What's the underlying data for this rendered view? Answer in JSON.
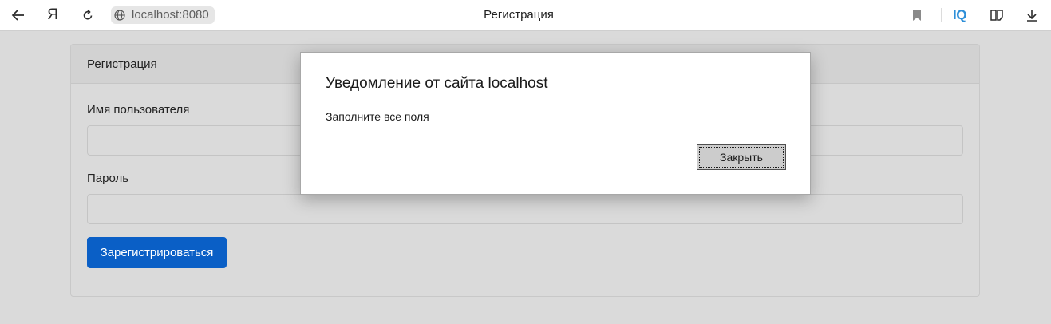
{
  "browser": {
    "address": "localhost:8080",
    "tab_title": "Регистрация",
    "yandex_label": "Я",
    "iq_label": "IQ",
    "icons": [
      "back-arrow-icon",
      "yandex-logo-icon",
      "reload-icon",
      "globe-icon",
      "bookmark-icon",
      "iq-icon",
      "book-icon",
      "download-icon"
    ]
  },
  "page": {
    "card_title": "Регистрация",
    "username_label": "Имя пользователя",
    "username_value": "",
    "password_label": "Пароль",
    "password_value": "",
    "submit_label": "Зарегистрироваться",
    "accent_color": "#0a5fc6"
  },
  "dialog": {
    "title": "Уведомление от сайта localhost",
    "message": "Заполните все поля",
    "close_label": "Закрыть"
  }
}
